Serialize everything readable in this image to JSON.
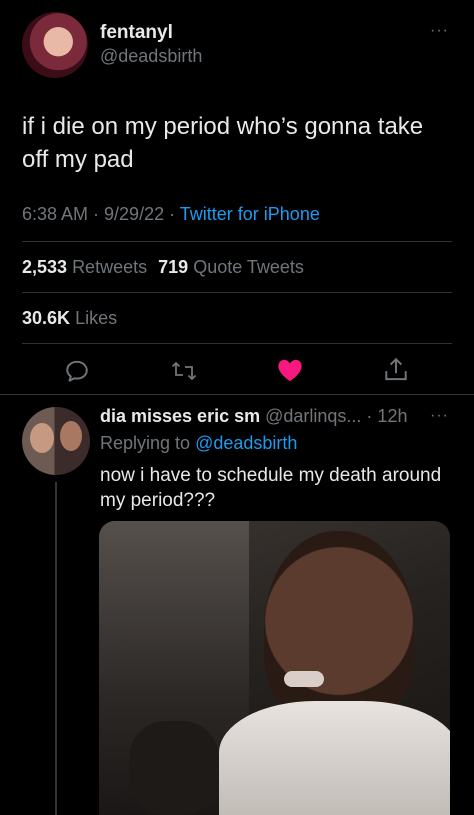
{
  "tweet": {
    "display_name": "fentanyl",
    "handle": "@deadsbirth",
    "text": "if i die on my period who’s gonna take off my pad",
    "time": "6:38 AM · 9/29/22 ·",
    "source": "Twitter for iPhone",
    "retweets_count": "2,533",
    "retweets_label": "Retweets",
    "quotes_count": "719",
    "quotes_label": "Quote Tweets",
    "likes_count": "30.6K",
    "likes_label": "Likes",
    "more": "···"
  },
  "reply": {
    "display_name": "dia misses eric sm",
    "handle_time": "@darlinqs... · 12h",
    "replying_prefix": "Replying to",
    "replying_handle": "@deadsbirth",
    "text": "now i have to schedule my death around my period???",
    "more": "···"
  },
  "colors": {
    "accent": "#1d9bf0",
    "like": "#f91880",
    "text": "#e7e9ea",
    "muted": "#71767b",
    "background": "#000000"
  }
}
